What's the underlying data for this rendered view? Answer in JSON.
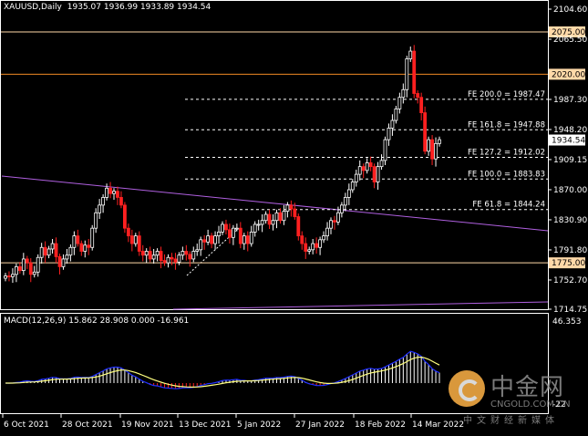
{
  "header": {
    "symbol": "XAUUSD,Daily",
    "ohlc": "1935.07 1936.99 1933.89 1934.54"
  },
  "macd": {
    "label": "MACD(12,26,9) 15.862 28.908 0.000 -16.961",
    "scale_labels": [
      "46.353",
      "-22"
    ]
  },
  "price_axis": {
    "labels": [
      "2104.60",
      "2065.50",
      "1987.30",
      "1948.20",
      "1909.15",
      "1870.00",
      "1830.90",
      "1791.80",
      "1752.70",
      "1714.75"
    ]
  },
  "time_axis": {
    "labels": [
      "6 Oct 2021",
      "28 Oct 2021",
      "19 Nov 2021",
      "13 Dec 2021",
      "5 Jan 2022",
      "27 Jan 2022",
      "18 Feb 2022",
      "14 Mar 2022"
    ]
  },
  "current_price": {
    "label": "1934.54",
    "value": 1934.54
  },
  "levels": [
    {
      "label": "2075.00",
      "value": 2075.0,
      "color": "#ffd9a8"
    },
    {
      "label": "2020.00",
      "value": 2020.0,
      "color": "#f08a24"
    },
    {
      "label": "1775.00",
      "value": 1775.0,
      "color": "#ffd9a8"
    }
  ],
  "fib_levels": [
    {
      "label": "FE 200.0 = 1987.47",
      "value": 1987.47
    },
    {
      "label": "FE 161.8 = 1947.88",
      "value": 1947.88
    },
    {
      "label": "FE 127.2 = 1912.02",
      "value": 1912.02
    },
    {
      "label": "FE 100.0 = 1883.83",
      "value": 1883.83
    },
    {
      "label": "FE 61.8 = 1844.24",
      "value": 1844.24
    }
  ],
  "colors": {
    "up": "#ffffff",
    "down": "#ff2020",
    "trendline": "#b060e0",
    "macd_line": "#2030ff",
    "signal_line": "#ffff80",
    "hist_up": "#ffffff",
    "hist_down": "#ff2020"
  },
  "watermark": {
    "logo_text": "中金网",
    "site": "CNGOLD.COM.CN",
    "subtitle": "中文财经新媒体"
  },
  "chart_data": {
    "type": "candlestick",
    "symbol": "XAUUSD",
    "timeframe": "Daily",
    "ylim": [
      1714.75,
      2104.6
    ],
    "closes": [
      1758,
      1757,
      1760,
      1770,
      1765,
      1780,
      1775,
      1760,
      1763,
      1782,
      1795,
      1785,
      1793,
      1800,
      1783,
      1770,
      1780,
      1785,
      1795,
      1810,
      1800,
      1790,
      1798,
      1795,
      1820,
      1840,
      1850,
      1860,
      1872,
      1865,
      1868,
      1860,
      1850,
      1820,
      1810,
      1800,
      1810,
      1790,
      1785,
      1790,
      1780,
      1785,
      1790,
      1778,
      1775,
      1782,
      1780,
      1776,
      1785,
      1790,
      1786,
      1780,
      1790,
      1792,
      1805,
      1802,
      1810,
      1800,
      1810,
      1815,
      1825,
      1818,
      1808,
      1820,
      1820,
      1800,
      1810,
      1800,
      1815,
      1825,
      1825,
      1830,
      1838,
      1825,
      1830,
      1840,
      1830,
      1842,
      1850,
      1845,
      1835,
      1810,
      1800,
      1790,
      1792,
      1800,
      1795,
      1805,
      1810,
      1820,
      1830,
      1828,
      1840,
      1850,
      1860,
      1870,
      1880,
      1890,
      1900,
      1895,
      1905,
      1900,
      1880,
      1900,
      1908,
      1935,
      1950,
      1960,
      1975,
      1990,
      2000,
      2040,
      2050,
      1995,
      1990,
      1970,
      1920,
      1935,
      1910,
      1930,
      1935
    ]
  }
}
